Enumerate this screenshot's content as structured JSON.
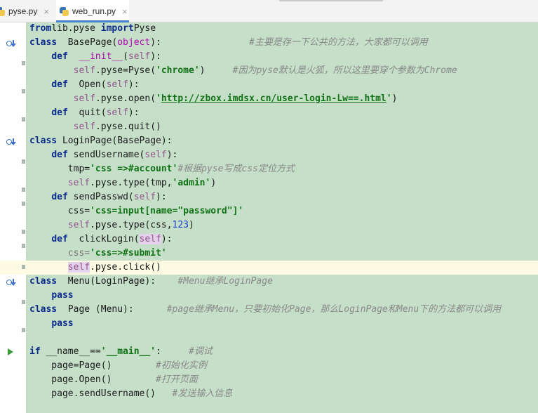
{
  "tabs": [
    {
      "label": "pyse.py",
      "close": "×",
      "active": false
    },
    {
      "label": "web_run.py",
      "close": "×",
      "active": true
    }
  ],
  "colors": {
    "keyword": "#0c2a8c",
    "self": "#94558d",
    "string": "#117316",
    "comment": "#8a8a8a",
    "number": "#1e3fcf",
    "editor_background": "#c5dfc8",
    "current_line": "#fdfbe4",
    "active_tab_underline": "#4083c9"
  },
  "code": [
    [
      [
        "kw",
        "from"
      ],
      [
        "",
        "lib.pyse "
      ],
      [
        "kw",
        "import"
      ],
      [
        "",
        "Pyse"
      ]
    ],
    [
      [
        "kw",
        "class"
      ],
      [
        "",
        "  BasePage("
      ],
      [
        "fn",
        "object"
      ],
      [
        "",
        "):                "
      ],
      [
        "cm",
        "#主要是存一下公共的方法，大家都可以调用"
      ]
    ],
    [
      [
        "",
        "    "
      ],
      [
        "kw",
        "def"
      ],
      [
        "",
        "  "
      ],
      [
        "fn",
        "__init__"
      ],
      [
        "",
        "("
      ],
      [
        "self",
        "self"
      ],
      [
        "",
        "):"
      ]
    ],
    [
      [
        "",
        "        "
      ],
      [
        "self",
        "self"
      ],
      [
        "",
        ".pyse=Pyse("
      ],
      [
        "str",
        "'chrome'"
      ],
      [
        "",
        ")     "
      ],
      [
        "cm",
        "#因为pyse默认是火狐，所以这里要穿个参数为Chrome"
      ]
    ],
    [
      [
        "",
        "    "
      ],
      [
        "kw",
        "def"
      ],
      [
        "",
        "  Open("
      ],
      [
        "self",
        "self"
      ],
      [
        "",
        "):"
      ]
    ],
    [
      [
        "",
        "        "
      ],
      [
        "self",
        "self"
      ],
      [
        "",
        ".pyse.open("
      ],
      [
        "str",
        "'"
      ],
      [
        "url",
        "http://zbox.imdsx.cn/user-login-Lw==.html"
      ],
      [
        "str",
        "'"
      ],
      [
        "",
        ")"
      ]
    ],
    [
      [
        "",
        "    "
      ],
      [
        "kw",
        "def"
      ],
      [
        "",
        "  quit("
      ],
      [
        "self",
        "self"
      ],
      [
        "",
        "):"
      ]
    ],
    [
      [
        "",
        "        "
      ],
      [
        "self",
        "self"
      ],
      [
        "",
        ".pyse.quit()"
      ]
    ],
    [
      [
        "kw",
        "class"
      ],
      [
        "",
        " LoginPage(BasePage):"
      ]
    ],
    [
      [
        "",
        "    "
      ],
      [
        "kw",
        "def"
      ],
      [
        "",
        " sendUsername("
      ],
      [
        "self",
        "self"
      ],
      [
        "",
        "):"
      ]
    ],
    [
      [
        "",
        "       tmp="
      ],
      [
        "str",
        "'css =>#account'"
      ],
      [
        "",
        "",
        " "
      ],
      [
        "cm",
        "#根据pyse写成css定位方式"
      ]
    ],
    [
      [
        "",
        "       "
      ],
      [
        "self",
        "self"
      ],
      [
        "",
        ".pyse.type(tmp,"
      ],
      [
        "str",
        "'admin'"
      ],
      [
        "",
        ")"
      ]
    ],
    [
      [
        "",
        "    "
      ],
      [
        "kw",
        "def"
      ],
      [
        "",
        " sendPasswd("
      ],
      [
        "self",
        "self"
      ],
      [
        "",
        "):"
      ]
    ],
    [
      [
        "",
        "       css="
      ],
      [
        "str",
        "'css=input[name=\"password\"]'"
      ]
    ],
    [
      [
        "",
        "       "
      ],
      [
        "self",
        "self"
      ],
      [
        "",
        ".pyse.type(css,"
      ],
      [
        "num",
        "123"
      ],
      [
        "",
        ")"
      ]
    ],
    [
      [
        "",
        "    "
      ],
      [
        "kw",
        "def"
      ],
      [
        "",
        "  clickLogin("
      ],
      [
        "hl self",
        "self"
      ],
      [
        "",
        "):"
      ]
    ],
    [
      [
        "dim",
        "       css="
      ],
      [
        "str",
        "'css=>#submit'"
      ]
    ],
    [
      [
        "",
        "       "
      ],
      [
        "hl self",
        "self"
      ],
      [
        "",
        ".pyse.click()"
      ]
    ],
    [
      [
        "kw",
        "class"
      ],
      [
        "",
        "  Menu(LoginPage):    "
      ],
      [
        "cm",
        "#Menu继承LoginPage"
      ]
    ],
    [
      [
        "",
        "    "
      ],
      [
        "kw",
        "pass"
      ]
    ],
    [
      [
        "kw",
        "class"
      ],
      [
        "",
        "  Page (Menu):      "
      ],
      [
        "cm",
        "#page继承Menu，只要初始化Page，那么LoginPage和Menu下的方法都可以调用"
      ]
    ],
    [
      [
        "",
        "    "
      ],
      [
        "kw",
        "pass"
      ]
    ],
    [
      [
        "",
        ""
      ]
    ],
    [
      [
        "kw",
        "if"
      ],
      [
        "",
        " __name__=="
      ],
      [
        "str",
        "'__main__'"
      ],
      [
        "",
        ":     "
      ],
      [
        "cm",
        "#调试"
      ]
    ],
    [
      [
        "",
        "    page=Page()        "
      ],
      [
        "cm",
        "#初始化实例"
      ]
    ],
    [
      [
        "",
        "    page.Open()        "
      ],
      [
        "cm",
        "#打开页面"
      ]
    ],
    [
      [
        "",
        "    page.sendUsername()   "
      ],
      [
        "cm",
        "#发送输入信息"
      ]
    ]
  ]
}
